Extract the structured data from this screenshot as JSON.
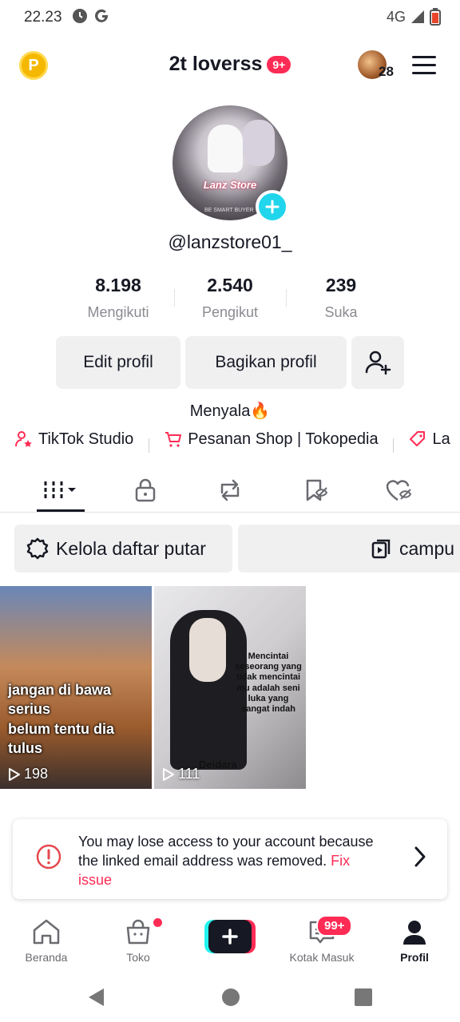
{
  "status_bar": {
    "time": "22.23",
    "network": "4G"
  },
  "header": {
    "title": "2t loverss",
    "title_badge": "9+",
    "coin_letter": "P",
    "friends_count": "28"
  },
  "profile": {
    "photo_text": "Lanz Store",
    "photo_subtext": "BE SMART BUYER",
    "username": "@lanzstore01_",
    "bio": "Menyala🔥"
  },
  "stats": [
    {
      "value": "8.198",
      "label": "Mengikuti"
    },
    {
      "value": "2.540",
      "label": "Pengikut"
    },
    {
      "value": "239",
      "label": "Suka"
    }
  ],
  "actions": {
    "edit": "Edit profil",
    "share": "Bagikan profil"
  },
  "links": [
    {
      "label": "TikTok Studio",
      "icon": "person-star-icon"
    },
    {
      "label": "Pesanan Shop | Tokopedia",
      "icon": "cart-icon"
    },
    {
      "label": "La",
      "icon": "tag-icon"
    }
  ],
  "tabs": [
    "videos-grid-icon",
    "lock-icon",
    "repost-icon",
    "bookmark-icon",
    "liked-icon"
  ],
  "chips": {
    "playlist": "Kelola daftar putar",
    "compilation": "campu"
  },
  "videos": [
    {
      "caption_line1": "jangan di bawa serius",
      "caption_line2": "belum tentu dia tulus",
      "views": "198"
    },
    {
      "quote": "Mencintai seseorang yang tidak mencintai mu adalah seni luka yang sangat indah",
      "name": "Deidara",
      "views": "111"
    }
  ],
  "warning": {
    "text": "You may lose access to your account because the linked email address was removed.",
    "link": "Fix issue"
  },
  "bottom_nav": [
    {
      "label": "Beranda"
    },
    {
      "label": "Toko"
    },
    {
      "label": ""
    },
    {
      "label": "Kotak Masuk",
      "badge": "99+"
    },
    {
      "label": "Profil"
    }
  ],
  "colors": {
    "accent": "#fe2c55",
    "cyan": "#20d5ec",
    "text": "#161823",
    "muted": "#8a8b91"
  }
}
